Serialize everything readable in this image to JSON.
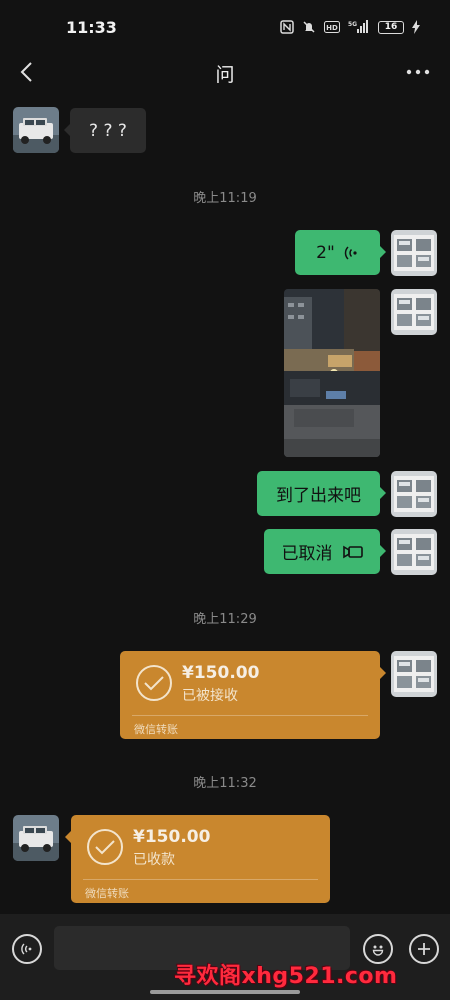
{
  "status_bar": {
    "time": "11:33",
    "battery": "16",
    "icons": [
      "nfc-icon",
      "mute-icon",
      "hd-icon",
      "5g-signal-icon",
      "battery-icon",
      "charging-icon"
    ],
    "hd_text": "HD",
    "net_text": "5G"
  },
  "nav": {
    "title": "问",
    "back_icon": "chevron-left-icon",
    "more_icon": "more-icon"
  },
  "messages": [
    {
      "sender": "contact",
      "type": "text",
      "text": "? ? ?"
    },
    {
      "type": "timestamp",
      "text": "晚上11:19"
    },
    {
      "sender": "me",
      "type": "voice",
      "duration": "2\""
    },
    {
      "sender": "me",
      "type": "image",
      "description_icon": "photo"
    },
    {
      "sender": "me",
      "type": "text",
      "text": "到了出来吧"
    },
    {
      "sender": "me",
      "type": "call",
      "text": "已取消",
      "icon": "video-call-icon"
    },
    {
      "type": "timestamp",
      "text": "晚上11:29"
    },
    {
      "sender": "me",
      "type": "transfer",
      "amount": "¥150.00",
      "status": "已被接收",
      "footer": "微信转账"
    },
    {
      "type": "timestamp",
      "text": "晚上11:32"
    },
    {
      "sender": "contact",
      "type": "transfer",
      "amount": "¥150.00",
      "status": "已收款",
      "footer": "微信转账"
    }
  ],
  "input_bar": {
    "voice_icon": "voice-input-icon",
    "emoji_icon": "emoji-icon",
    "plus_icon": "plus-icon",
    "placeholder": ""
  },
  "watermark": "寻欢阁xhg521.com",
  "colors": {
    "background": "#121212",
    "outgoing_bubble": "#3eb871",
    "incoming_bubble": "#2c2c2c",
    "transfer_card": "#c9872e",
    "watermark": "#ff2a3d"
  }
}
